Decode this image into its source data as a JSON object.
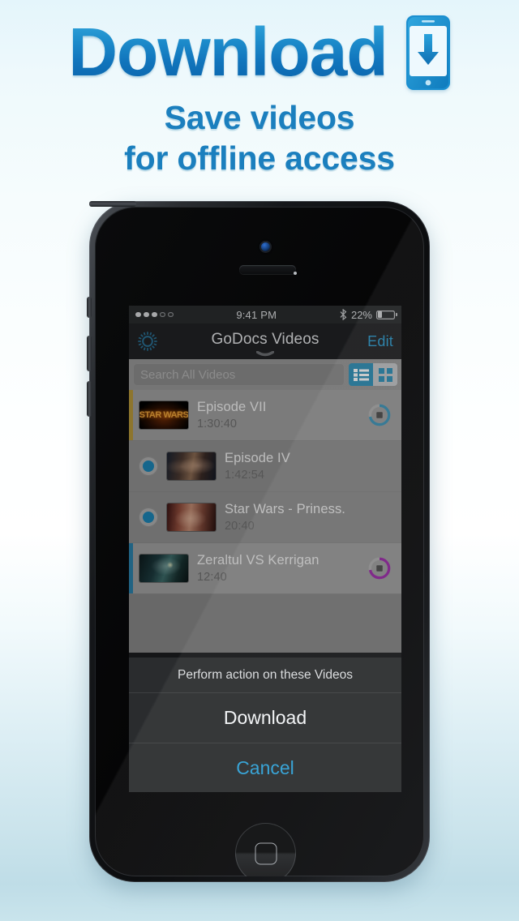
{
  "header": {
    "title": "Download",
    "subtitle_line1": "Save videos",
    "subtitle_line2": "for offline access",
    "icon": "phone-download-icon",
    "title_color": "#1b8ccc",
    "subtitle_color": "#1b7fbe"
  },
  "phone": {
    "statusbar": {
      "signal_dots_filled": 3,
      "signal_dots_total": 5,
      "time": "9:41 PM",
      "bluetooth_icon": "bluetooth-icon",
      "battery_percent": "22%",
      "battery_level": 22
    },
    "navbar": {
      "settings_icon": "gear-icon",
      "title": "GoDocs Videos",
      "chevron_icon": "chevron-down-icon",
      "edit_label": "Edit",
      "accent_color": "#2e9fd4"
    },
    "searchbar": {
      "placeholder": "Search All Videos",
      "value": "",
      "view_list_icon": "list-view-icon",
      "view_grid_icon": "grid-view-icon",
      "selected_view": "list",
      "selected_color": "#2b8fb8"
    },
    "list": {
      "rows": [
        {
          "title": "Episode VII",
          "duration": "1:30:40",
          "thumb": "star-wars-logo-thumbnail",
          "thumb_class": "t-sw",
          "thumb_caption": "STAR WARS",
          "selected": false,
          "has_radio": false,
          "edge_color": "#b5973a",
          "ring": {
            "color": "#3a93b8",
            "progress": 72,
            "icon": "stop-square-icon"
          },
          "row_shade": "light"
        },
        {
          "title": "Episode IV",
          "duration": "1:42:54",
          "thumb": "episode-iv-thumbnail",
          "thumb_class": "t-ep4",
          "thumb_caption": "",
          "selected": true,
          "has_radio": true,
          "edge_color": "",
          "ring": null,
          "row_shade": "dark"
        },
        {
          "title": "Star Wars - Priness.",
          "duration": "20:40",
          "thumb": "princess-thumbnail",
          "thumb_class": "t-prin",
          "thumb_caption": "",
          "selected": true,
          "has_radio": true,
          "edge_color": "",
          "ring": null,
          "row_shade": "dark"
        },
        {
          "title": "Zeraltul VS Kerrigan",
          "duration": "12:40",
          "thumb": "zeratul-thumbnail",
          "thumb_class": "t-zer",
          "thumb_caption": "",
          "selected": false,
          "has_radio": false,
          "edge_color": "#2b7fa8",
          "ring": {
            "color": "#9b27a8",
            "progress": 72,
            "icon": "stop-square-icon"
          },
          "row_shade": "light"
        }
      ]
    },
    "action_sheet": {
      "title": "Perform action on these Videos",
      "download_label": "Download",
      "cancel_label": "Cancel",
      "cancel_color": "#2e9fd4"
    }
  }
}
